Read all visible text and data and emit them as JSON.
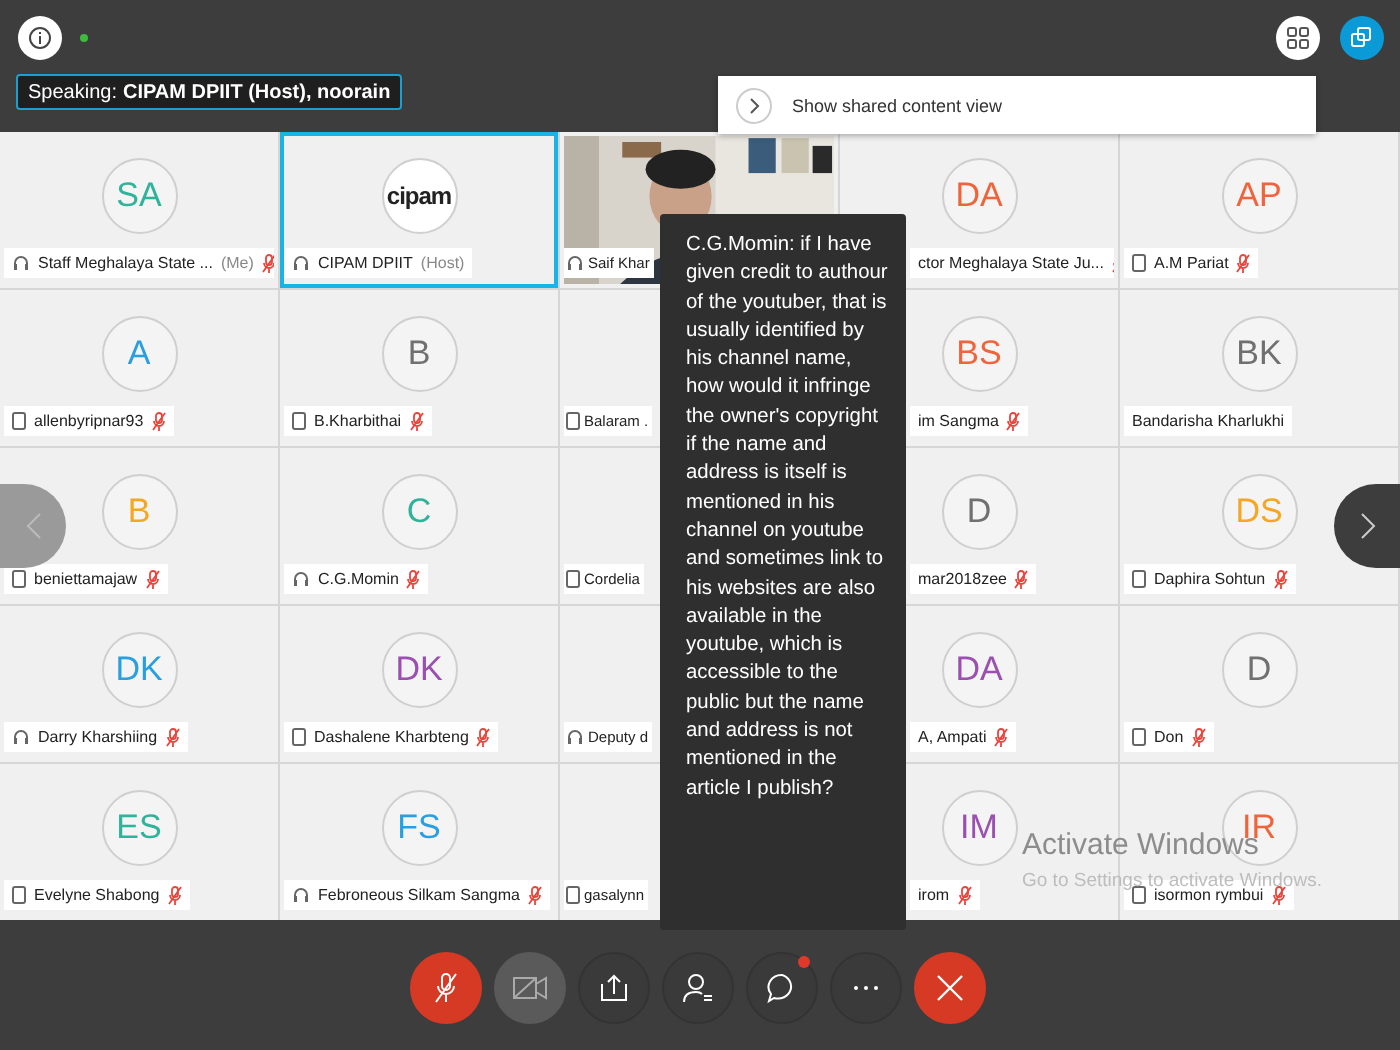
{
  "top_bar": {
    "presence_dot": {
      "color": "#3dbb3d"
    },
    "speaking": {
      "label": "Speaking:",
      "names": "CIPAM DPIIT (Host), noorain"
    }
  },
  "popup": {
    "label": "Show shared content view"
  },
  "tiles": [
    {
      "initials": "SA",
      "color": "#2fb39a",
      "name": "Staff Meghalaya State ...",
      "tag": "(Me)",
      "on_phone": false,
      "muted": true,
      "selected": false
    },
    {
      "logo": "cipam",
      "name": "CIPAM DPIIT",
      "tag": "(Host)",
      "on_phone": false,
      "muted": false,
      "selected": true
    },
    {
      "kind": "picture",
      "name": "Saif Khar",
      "on_phone": false,
      "muted": false,
      "selected": false
    },
    {
      "initials": "DA",
      "color": "#f0643c",
      "name": "ctor Meghalaya State Ju...",
      "muted": true,
      "selected": false
    },
    {
      "initials": "AP",
      "color": "#f0643c",
      "name": "A.M Pariat",
      "on_phone": true,
      "muted": true,
      "selected": false
    },
    {
      "initials": "A",
      "color": "#2a9fe0",
      "name": "allenbyripnar93",
      "on_phone": true,
      "muted": true,
      "selected": false
    },
    {
      "initials": "B",
      "color": "#707070",
      "name": "B.Kharbithai",
      "on_phone": true,
      "muted": true,
      "selected": false
    },
    {
      "name": "Balaram .",
      "on_phone": true,
      "muted": false,
      "selected": false
    },
    {
      "initials": "BS",
      "color": "#f0643c",
      "name": "im Sangma",
      "muted": true,
      "selected": false
    },
    {
      "initials": "BK",
      "color": "#707070",
      "name": "Bandarisha Kharlukhi",
      "muted": false,
      "selected": false
    },
    {
      "initials": "B",
      "color": "#f5a623",
      "name": "beniettamajaw",
      "on_phone": true,
      "muted": true,
      "selected": false
    },
    {
      "initials": "C",
      "color": "#2fb39a",
      "name": "C.G.Momin",
      "on_phone": false,
      "muted": true,
      "selected": false
    },
    {
      "name": "Cordelia",
      "on_phone": true,
      "muted": false,
      "selected": false
    },
    {
      "initials": "D",
      "color": "#707070",
      "name": "mar2018zee",
      "muted": true,
      "selected": false
    },
    {
      "initials": "DS",
      "color": "#f5a623",
      "name": "Daphira Sohtun",
      "on_phone": true,
      "muted": true,
      "selected": false
    },
    {
      "initials": "DK",
      "color": "#2a9fe0",
      "name": "Darry Kharshiing",
      "on_phone": false,
      "muted": true,
      "selected": false
    },
    {
      "initials": "DK",
      "color": "#9b4fb0",
      "name": "Dashalene Kharbteng",
      "on_phone": true,
      "muted": true,
      "selected": false
    },
    {
      "name": "Deputy d",
      "on_phone": false,
      "muted": false,
      "selected": false
    },
    {
      "initials": "DA",
      "color": "#9b4fb0",
      "name": "A, Ampati",
      "muted": true,
      "selected": false
    },
    {
      "initials": "D",
      "color": "#707070",
      "name": "Don",
      "on_phone": true,
      "muted": true,
      "selected": false
    },
    {
      "initials": "ES",
      "color": "#2fb39a",
      "name": "Evelyne Shabong",
      "on_phone": true,
      "muted": true,
      "selected": false
    },
    {
      "initials": "FS",
      "color": "#2a9fe0",
      "name": "Febroneous Silkam Sangma",
      "on_phone": false,
      "muted": true,
      "selected": false
    },
    {
      "name": "gasalynn",
      "on_phone": true,
      "muted": false,
      "selected": false
    },
    {
      "initials": "IM",
      "color": "#9b4fb0",
      "name": "irom",
      "muted": true,
      "selected": false
    },
    {
      "initials": "IR",
      "color": "#f0643c",
      "name": "isormon rymbui",
      "on_phone": true,
      "muted": true,
      "selected": false
    }
  ],
  "tooltip": {
    "text": "C.G.Momin: if I have given credit to authour of the youtuber, that is usually identified by his channel name, how would it infringe the owner's copyright if the name and address is itself is mentioned in his channel on youtube and sometimes link to his websites are also available in the youtube, which is accessible to the public but the name and address is not mentioned in the article I publish?"
  },
  "controls": [
    {
      "kind": "mic",
      "muted": true
    },
    {
      "kind": "video",
      "muted": true
    },
    {
      "kind": "share"
    },
    {
      "kind": "participants"
    },
    {
      "kind": "chat",
      "badge": true
    },
    {
      "kind": "more"
    },
    {
      "kind": "leave"
    }
  ],
  "os_notice": {
    "title": "Activate Windows",
    "subtitle": "Go to Settings to activate Windows."
  }
}
